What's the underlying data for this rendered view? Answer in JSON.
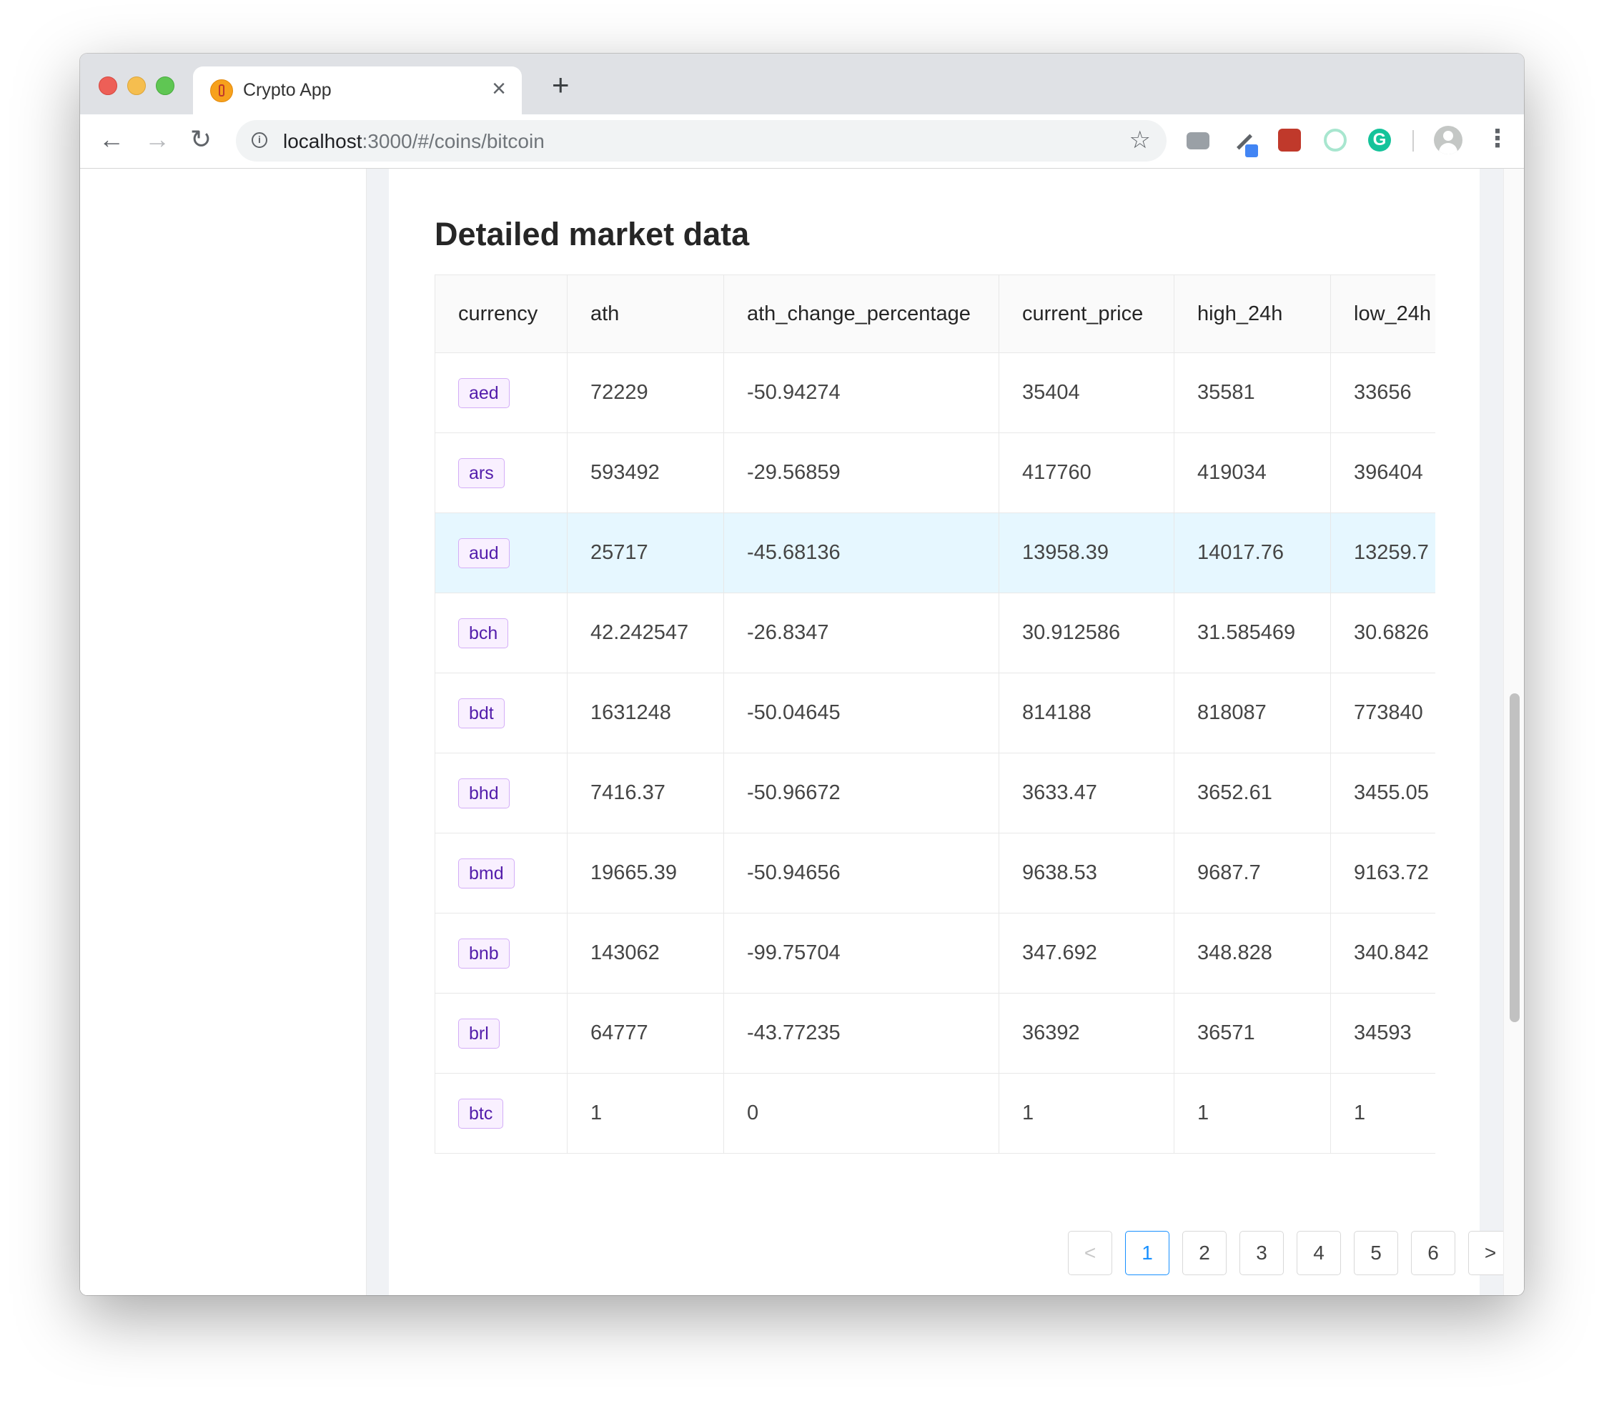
{
  "browser": {
    "tab_title": "Crypto App",
    "url_host": "localhost",
    "url_path": ":3000/#/coins/bitcoin"
  },
  "page": {
    "title": "Detailed market data"
  },
  "table": {
    "columns": [
      "currency",
      "ath",
      "ath_change_percentage",
      "current_price",
      "high_24h",
      "low_24h"
    ],
    "rows": [
      {
        "currency": "aed",
        "ath": "72229",
        "ath_change_percentage": "-50.94274",
        "current_price": "35404",
        "high_24h": "35581",
        "low_24h": "33656"
      },
      {
        "currency": "ars",
        "ath": "593492",
        "ath_change_percentage": "-29.56859",
        "current_price": "417760",
        "high_24h": "419034",
        "low_24h": "396404"
      },
      {
        "currency": "aud",
        "ath": "25717",
        "ath_change_percentage": "-45.68136",
        "current_price": "13958.39",
        "high_24h": "14017.76",
        "low_24h": "13259.7"
      },
      {
        "currency": "bch",
        "ath": "42.242547",
        "ath_change_percentage": "-26.8347",
        "current_price": "30.912586",
        "high_24h": "31.585469",
        "low_24h": "30.6826"
      },
      {
        "currency": "bdt",
        "ath": "1631248",
        "ath_change_percentage": "-50.04645",
        "current_price": "814188",
        "high_24h": "818087",
        "low_24h": "773840"
      },
      {
        "currency": "bhd",
        "ath": "7416.37",
        "ath_change_percentage": "-50.96672",
        "current_price": "3633.47",
        "high_24h": "3652.61",
        "low_24h": "3455.05"
      },
      {
        "currency": "bmd",
        "ath": "19665.39",
        "ath_change_percentage": "-50.94656",
        "current_price": "9638.53",
        "high_24h": "9687.7",
        "low_24h": "9163.72"
      },
      {
        "currency": "bnb",
        "ath": "143062",
        "ath_change_percentage": "-99.75704",
        "current_price": "347.692",
        "high_24h": "348.828",
        "low_24h": "340.842"
      },
      {
        "currency": "brl",
        "ath": "64777",
        "ath_change_percentage": "-43.77235",
        "current_price": "36392",
        "high_24h": "36571",
        "low_24h": "34593"
      },
      {
        "currency": "btc",
        "ath": "1",
        "ath_change_percentage": "0",
        "current_price": "1",
        "high_24h": "1",
        "low_24h": "1"
      }
    ],
    "highlighted_row": "aud"
  },
  "pagination": {
    "prev": "<",
    "next": ">",
    "pages": [
      "1",
      "2",
      "3",
      "4",
      "5",
      "6"
    ],
    "current": "1"
  },
  "colors": {
    "tag_border": "#d3adf7",
    "tag_bg": "#f9f0ff",
    "tag_text": "#531dab",
    "highlight_row": "#e6f7ff",
    "active_page": "#1890ff"
  }
}
